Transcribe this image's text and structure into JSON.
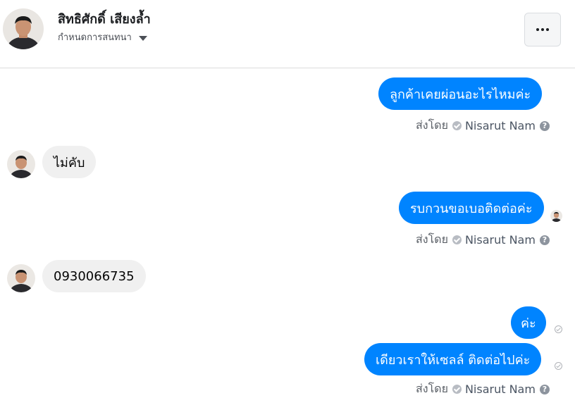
{
  "header": {
    "contact_name": "สิทธิศักดิ์ เสียงล้ำ",
    "subtitle": "กำหนดการสนทนา",
    "caret_icon": "caret-down-icon",
    "more_icon": "more-options-icon"
  },
  "colors": {
    "outgoing_bubble": "#0084ff",
    "incoming_bubble": "#f0f0f0"
  },
  "messages": [
    {
      "direction": "outgoing",
      "text": "ลูกค้าเคยผ่อนอะไรไหมค่ะ"
    },
    {
      "direction": "incoming",
      "text": "ไม่คับ"
    },
    {
      "direction": "outgoing",
      "text": "รบกวนขอเบอติดต่อค่ะ"
    },
    {
      "direction": "incoming",
      "text": "0930066735"
    },
    {
      "direction": "outgoing",
      "text": "ค่ะ"
    },
    {
      "direction": "outgoing",
      "text": "เดียวเราให้เซลล์ ติดต่อไปค่ะ"
    }
  ],
  "sent_by": {
    "label": "ส่งโดย",
    "sender": "Nisarut Nam",
    "help": "?"
  }
}
